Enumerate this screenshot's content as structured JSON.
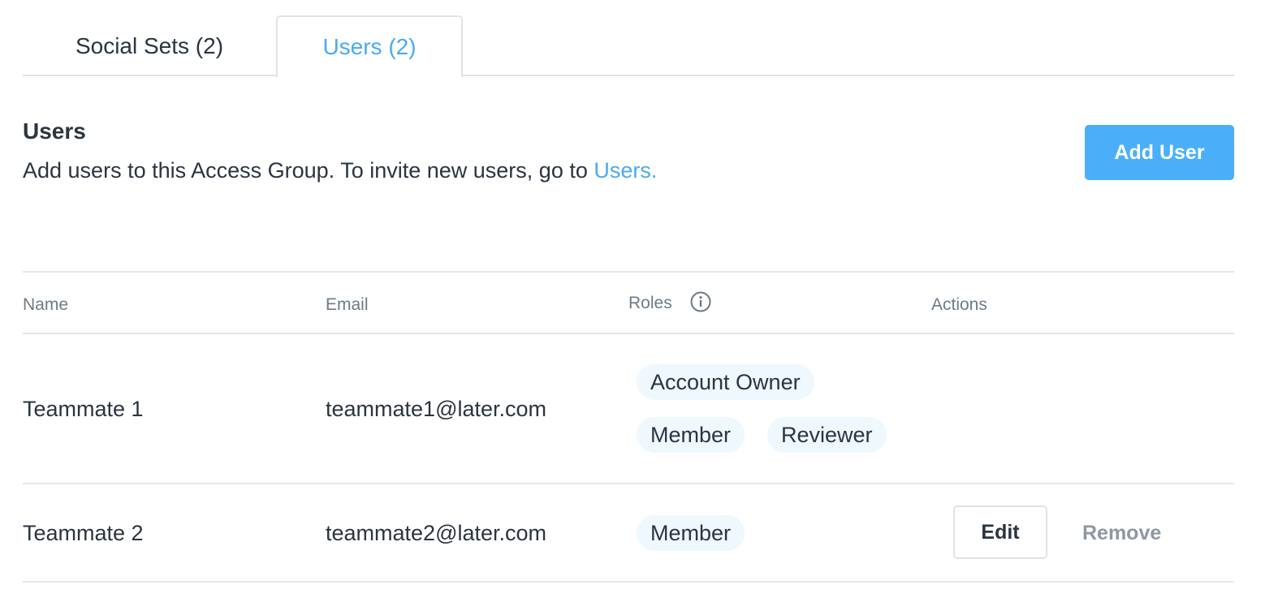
{
  "tabs": [
    {
      "label": "Social Sets (2)",
      "active": false
    },
    {
      "label": "Users (2)",
      "active": true
    }
  ],
  "section": {
    "title": "Users",
    "description_prefix": "Add users to this Access Group. To invite new users, go to ",
    "description_link": "Users.",
    "add_button_label": "Add User"
  },
  "table": {
    "headers": {
      "name": "Name",
      "email": "Email",
      "roles": "Roles",
      "actions": "Actions"
    },
    "rows": [
      {
        "name": "Teammate 1",
        "email": "teammate1@later.com",
        "roles": [
          "Account Owner",
          "Member",
          "Reviewer"
        ]
      },
      {
        "name": "Teammate 2",
        "email": "teammate2@later.com",
        "roles": [
          "Member"
        ],
        "actions": {
          "edit": "Edit",
          "remove": "Remove"
        }
      }
    ]
  },
  "colors": {
    "accent": "#4aaaf0",
    "button": "#4aaff8",
    "text": "#2b3440",
    "muted": "#6e7a86",
    "pill_bg": "#eef8fd",
    "divider": "#e3e7eb"
  },
  "icons": {
    "roles_info": "info-circle-icon"
  }
}
